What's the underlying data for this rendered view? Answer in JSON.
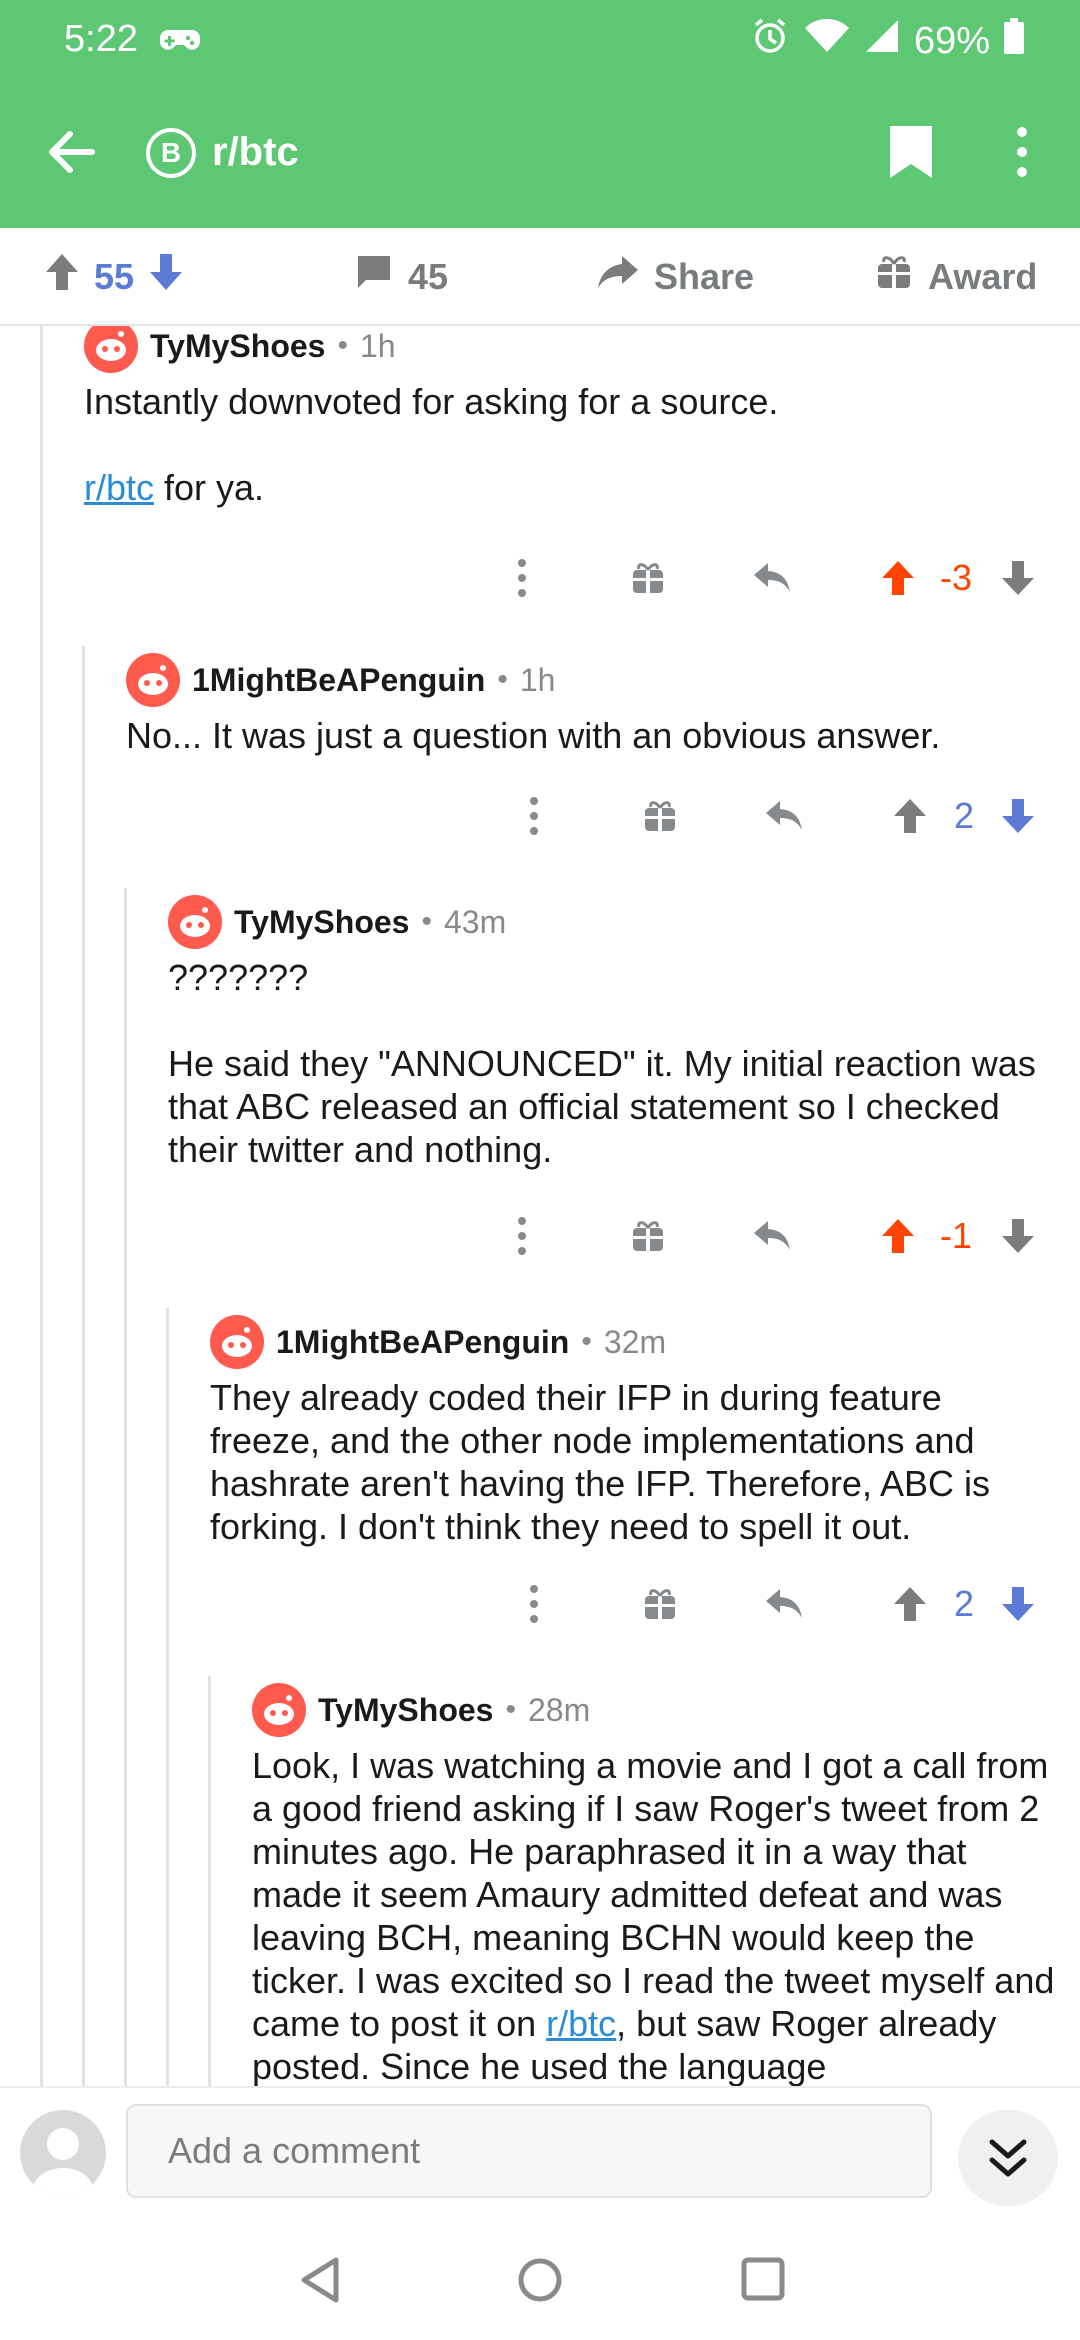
{
  "status_bar": {
    "time": "5:22",
    "battery": "69%"
  },
  "header": {
    "subreddit": "r/btc",
    "sub_icon_letter": "B"
  },
  "post_actions": {
    "score": "55",
    "comment_count": "45",
    "share_label": "Share",
    "award_label": "Award"
  },
  "colors": {
    "brand_green": "#5ec774",
    "upvote_orange": "#ff4500",
    "downvote_blue": "#5b7bd6",
    "link_blue": "#2a8bd6"
  },
  "comments": [
    {
      "author": "TyMyShoes",
      "time": "1h",
      "body": [
        "Instantly downvoted for asking for a source."
      ],
      "body2_link": "r/btc",
      "body2_rest": " for ya.",
      "score": "-3",
      "vote": "up"
    },
    {
      "author": "1MightBeAPenguin",
      "time": "1h",
      "body": [
        "No... It was just a question with an obvious answer."
      ],
      "score": "2",
      "vote": "down"
    },
    {
      "author": "TyMyShoes",
      "time": "43m",
      "body": [
        "???????",
        "He said they \"ANNOUNCED\" it. My initial reaction was that ABC released an official statement so I checked their twitter and nothing."
      ],
      "score": "-1",
      "vote": "up"
    },
    {
      "author": "1MightBeAPenguin",
      "time": "32m",
      "body": [
        "They already coded their IFP in during feature freeze, and the other node implementations and hashrate aren't having the IFP. Therefore, ABC is forking. I don't think they need to spell it out."
      ],
      "score": "2",
      "vote": "down"
    },
    {
      "author": "TyMyShoes",
      "time": "28m",
      "body_part1": "Look, I was watching a movie and I got a call from a good friend asking if I saw Roger's tweet from 2 minutes ago. He paraphrased it in a way that made it seem Amaury admitted defeat and was leaving BCH, meaning BCHN would keep the ticker. I was excited so I read the tweet myself and came to post it on ",
      "body_link": "r/btc",
      "body_part2": ", but saw Roger already posted. Since he used the language"
    }
  ],
  "composer": {
    "placeholder": "Add a comment"
  }
}
